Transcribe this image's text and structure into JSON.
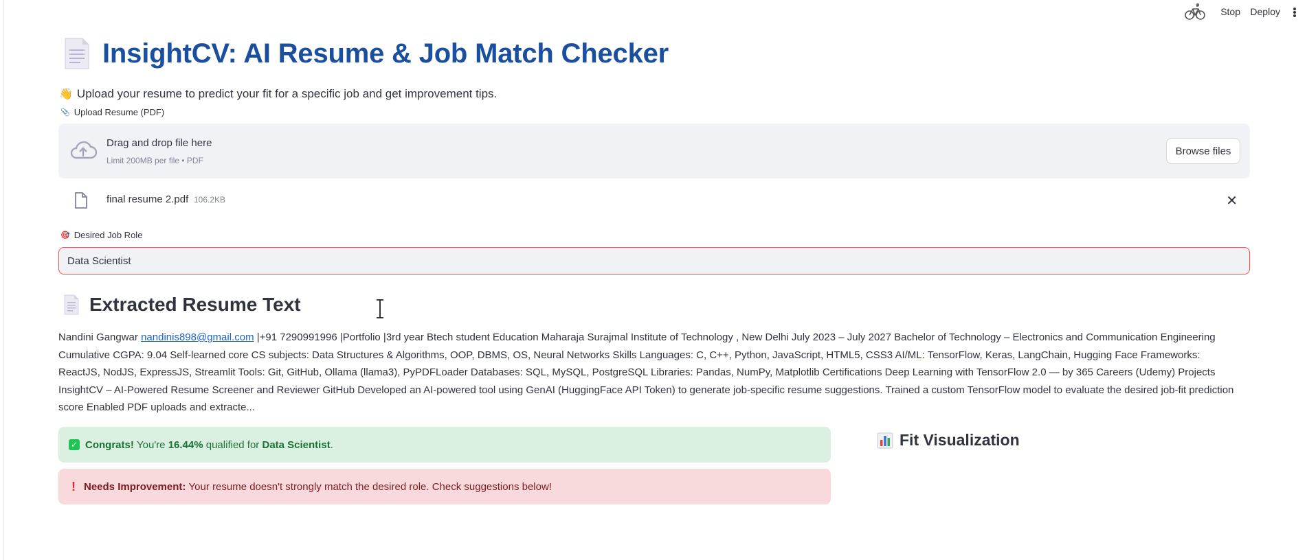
{
  "toolbar": {
    "stop_label": "Stop",
    "deploy_label": "Deploy",
    "running_icon": "bicycle-icon",
    "menu_icon": "kebab-menu-icon"
  },
  "header": {
    "title": "InsightCV: AI Resume & Job Match Checker",
    "title_icon": "page-facing-up-icon"
  },
  "intro": {
    "emoji": "👋",
    "text": "Upload your resume to predict your fit for a specific job and get improvement tips."
  },
  "uploader": {
    "label_emoji": "📎",
    "label": "Upload Resume (PDF)",
    "drop_title": "Drag and drop file here",
    "drop_subtitle": "Limit 200MB per file • PDF",
    "browse_label": "Browse files",
    "file": {
      "name": "final resume 2.pdf",
      "size": "106.2KB"
    }
  },
  "job_role": {
    "label_emoji": "🎯",
    "label": "Desired Job Role",
    "value": "Data Scientist"
  },
  "extracted": {
    "heading": "Extracted Resume Text",
    "name": "Nandini Gangwar",
    "email": "nandinis898@gmail.com",
    "body": "|+91 7290991996 |Portfolio |3rd year Btech student Education Maharaja Surajmal Institute of Technology , New Delhi July 2023 – July 2027 Bachelor of Technology – Electronics and Communication Engineering Cumulative CGPA: 9.04 Self-learned core CS subjects: Data Structures & Algorithms, OOP, DBMS, OS, Neural Networks Skills Languages: C, C++, Python, JavaScript, HTML5, CSS3 AI/ML: TensorFlow, Keras, LangChain, Hugging Face Frameworks: ReactJS, NodJS, ExpressJS, Streamlit Tools: Git, GitHub, Ollama (llama3), PyPDFLoader Databases: SQL, MySQL, PostgreSQL Libraries: Pandas, NumPy, Matplotlib Certifications Deep Learning with TensorFlow 2.0 — by 365 Careers (Udemy) Projects InsightCV – AI-Powered Resume Screener and Reviewer GitHub Developed an AI-powered tool using GenAI (HuggingFace API Token) to generate job-specific resume suggestions. Trained a custom TensorFlow model to evaluate the desired job-fit prediction score Enabled PDF uploads and extracte..."
  },
  "result": {
    "congrats": "Congrats!",
    "youre": "You're",
    "percent": "16.44%",
    "qualified_for": "qualified for",
    "role": "Data Scientist",
    "period": ".",
    "needs_label": "Needs Improvement:",
    "needs_text": "Your resume doesn't strongly match the desired role. Check suggestions below!"
  },
  "viz": {
    "heading": "Fit Visualization",
    "icon": "bar-chart-icon"
  },
  "colors": {
    "title": "#1a4fa0",
    "success_bg": "#dbf0e0",
    "error_bg": "#f9dadc",
    "input_border": "#ff4b4b",
    "link": "#1c62c9"
  }
}
